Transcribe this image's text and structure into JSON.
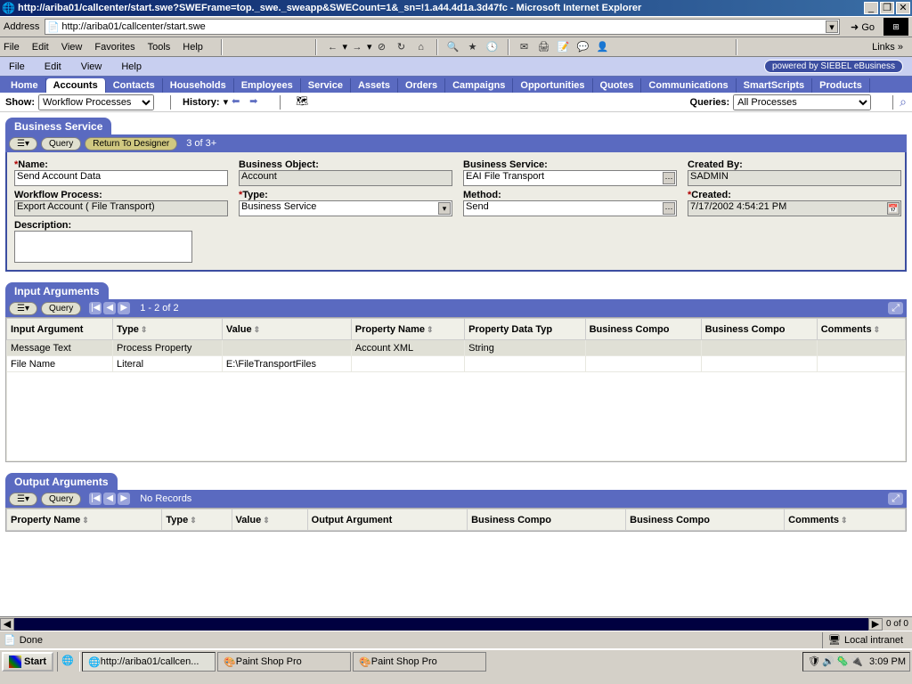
{
  "window": {
    "title": "http://ariba01/callcenter/start.swe?SWEFrame=top._swe._sweapp&SWECount=1&_sn=!1.a44.4d1a.3d47fc - Microsoft Internet Explorer",
    "address_label": "Address",
    "url": "http://ariba01/callcenter/start.swe",
    "go": "Go",
    "links": "Links"
  },
  "ie_menu": [
    "File",
    "Edit",
    "View",
    "Favorites",
    "Tools",
    "Help"
  ],
  "siebel_menu": [
    "File",
    "Edit",
    "View",
    "Help"
  ],
  "brand": "powered by SIEBEL eBusiness",
  "nav_tabs": [
    "Home",
    "Accounts",
    "Contacts",
    "Households",
    "Employees",
    "Service",
    "Assets",
    "Orders",
    "Campaigns",
    "Opportunities",
    "Quotes",
    "Communications",
    "SmartScripts",
    "Products"
  ],
  "toolbar": {
    "show": "Show:",
    "show_value": "Workflow Processes",
    "history": "History:",
    "queries": "Queries:",
    "queries_value": "All Processes"
  },
  "bs": {
    "title": "Business Service",
    "query": "Query",
    "return": "Return To Designer",
    "counter": "3 of 3+",
    "name_lbl": "Name:",
    "name_val": "Send Account Data",
    "wf_lbl": "Workflow Process:",
    "wf_val": "Export Account ( File Transport)",
    "desc_lbl": "Description:",
    "bo_lbl": "Business Object:",
    "bo_val": "Account",
    "type_lbl": "Type:",
    "type_val": "Business Service",
    "svc_lbl": "Business Service:",
    "svc_val": "EAI File Transport",
    "method_lbl": "Method:",
    "method_val": "Send",
    "createdby_lbl": "Created By:",
    "createdby_val": "SADMIN",
    "created_lbl": "Created:",
    "created_val": "7/17/2002 4:54:21 PM"
  },
  "in_args": {
    "title": "Input Arguments",
    "query": "Query",
    "counter": "1 - 2 of 2",
    "headers": [
      "Input Argument",
      "Type",
      "Value",
      "Property Name",
      "Property Data Typ",
      "Business Compo",
      "Business Compo",
      "Comments"
    ],
    "rows": [
      [
        "Message Text",
        "Process Property",
        "",
        "Account XML",
        "String",
        "",
        "",
        ""
      ],
      [
        "File Name",
        "Literal",
        "E:\\FileTransportFiles",
        "",
        "",
        "",
        "",
        ""
      ]
    ]
  },
  "out_args": {
    "title": "Output Arguments",
    "query": "Query",
    "counter": "No Records",
    "headers": [
      "Property Name",
      "Type",
      "Value",
      "Output Argument",
      "Business Compo",
      "Business Compo",
      "Comments"
    ]
  },
  "hscroll": "0 of 0",
  "status": "Done",
  "zone": "Local intranet",
  "taskbar": {
    "start": "Start",
    "items": [
      "http://ariba01/callcen...",
      "Paint Shop Pro",
      "Paint Shop Pro"
    ],
    "clock": "3:09 PM"
  }
}
